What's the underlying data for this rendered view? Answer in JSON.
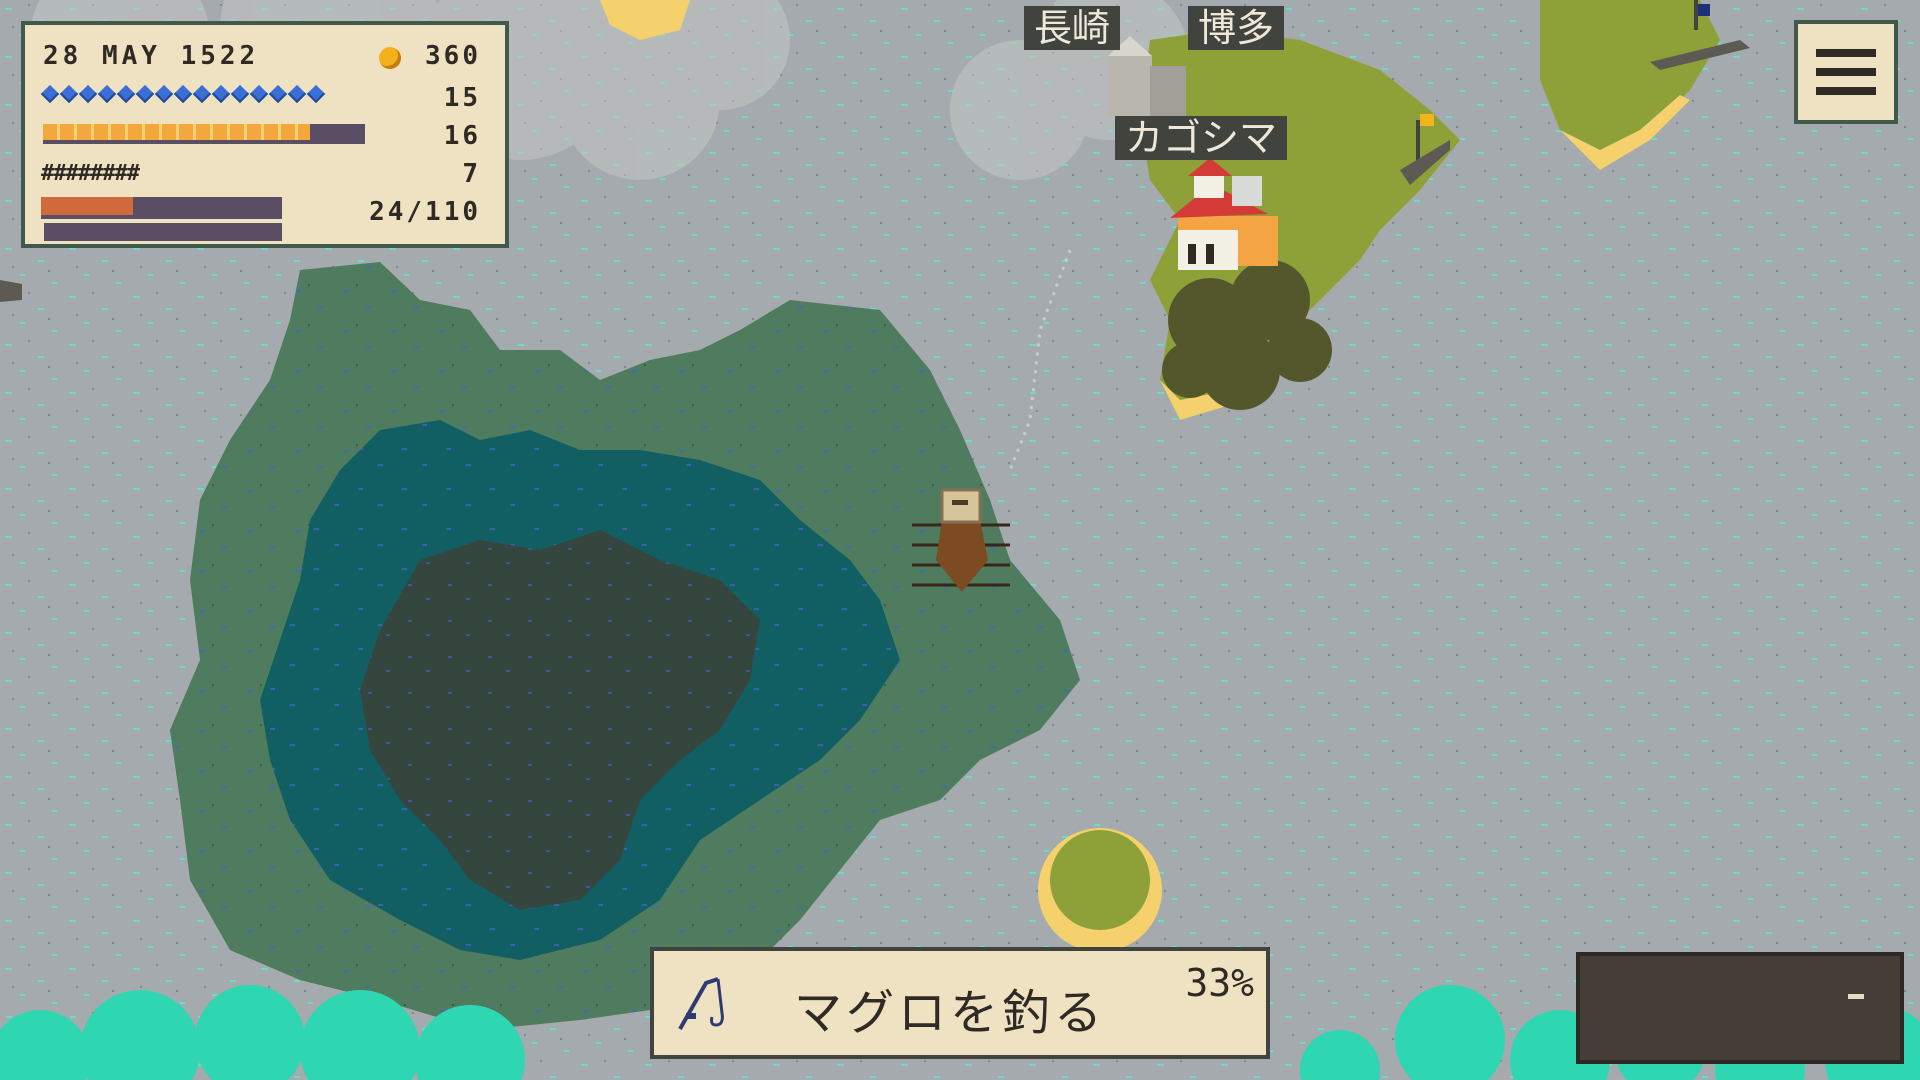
{
  "status": {
    "date": "28 MAY 1522",
    "gold": "360",
    "crew_count": "15",
    "crew_icon_count": 15,
    "food": "16",
    "food_fraction": 0.83,
    "cannon_glyphs": "########",
    "cannons": "7",
    "cargo": "24/110",
    "cargo_fraction": 0.38
  },
  "towns": {
    "nagasaki": "長崎",
    "hakata": "博多",
    "kagoshima": "カゴシマ"
  },
  "action": {
    "label": "マグロを釣る",
    "progress": "33%",
    "icon": "fishing-rod-icon"
  },
  "menu": {
    "icon": "hamburger-menu-icon"
  },
  "colors": {
    "sea": "#a4aaad",
    "shallow": "#4f7b5e",
    "deep": "#125f63",
    "deepest": "#35463f",
    "land": "#8ea038",
    "sand": "#f5d16e",
    "foam": "#2fd6b2",
    "panel": "#efe2c2"
  }
}
